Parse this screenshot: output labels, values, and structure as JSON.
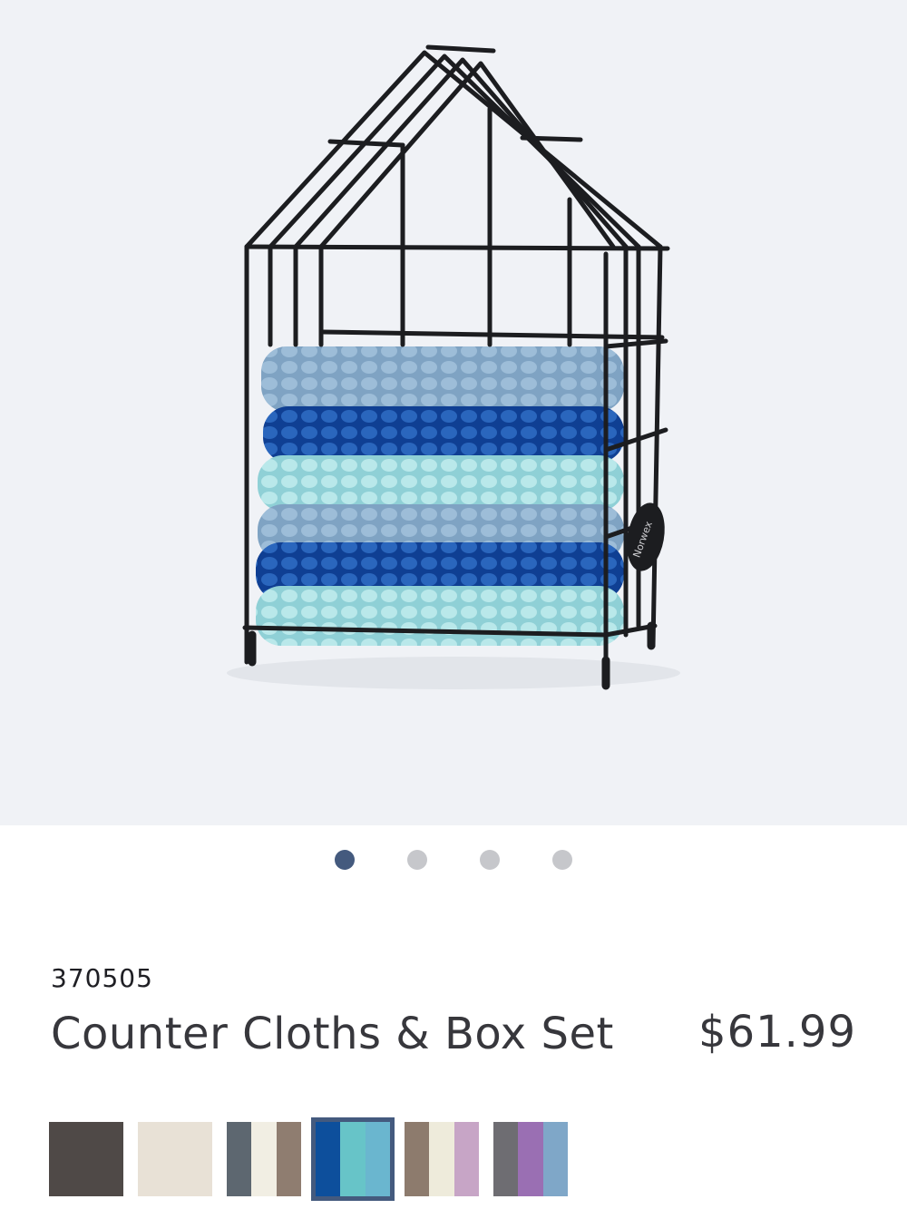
{
  "product": {
    "sku": "370505",
    "name": "Counter Cloths & Box Set",
    "price": "$61.99",
    "image_alt": "Counter cloths stacked in a black wire house-shaped box",
    "badge_text": "Norwex"
  },
  "carousel": {
    "total": 4,
    "active_index": 0
  },
  "swatches": [
    {
      "name": "swatch-1",
      "colors": [
        "#4f4947"
      ]
    },
    {
      "name": "swatch-2",
      "colors": [
        "#e8e1d6"
      ]
    },
    {
      "name": "swatch-3",
      "colors": [
        "#5d6770",
        "#f1eee3",
        "#8f7d70"
      ]
    },
    {
      "name": "swatch-4",
      "colors": [
        "#0d4f9c",
        "#67c4c8",
        "#6ab6cf"
      ],
      "selected": true
    },
    {
      "name": "swatch-5",
      "colors": [
        "#8d7b6d",
        "#eeebdb",
        "#c7a5c6"
      ]
    },
    {
      "name": "swatch-6",
      "colors": [
        "#6e6d72",
        "#9a6fb3",
        "#7fa7c8"
      ]
    }
  ],
  "colors": {
    "hero_bg": "#f0f2f6",
    "dot_active": "#445a7e",
    "dot_inactive": "#c6c7cb",
    "cloth_light_blue": "#8fb2cf",
    "cloth_royal_blue": "#1f59ad",
    "cloth_aqua": "#a9e0e4",
    "wire": "#1c1d20"
  }
}
